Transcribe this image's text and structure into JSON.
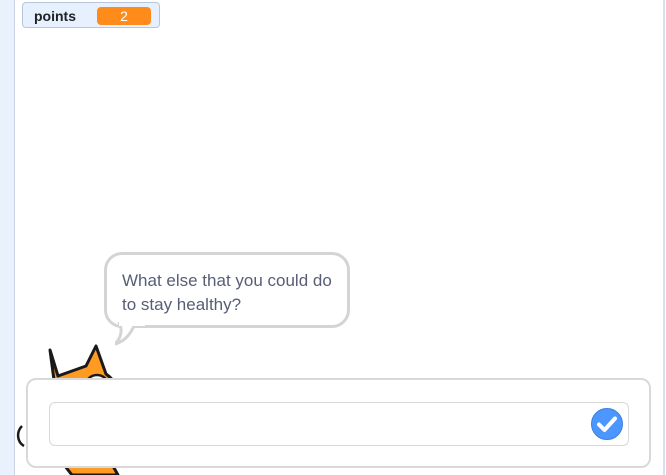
{
  "variable_monitor": {
    "label": "points",
    "value": "2"
  },
  "speech_bubble": {
    "text": "What else that you could do to stay healthy?"
  },
  "ask_prompt": {
    "answer_value": "",
    "submit_icon": "check-circle-icon"
  },
  "colors": {
    "monitor_value_bg": "#ff8c1a",
    "submit_blue": "#4c97ff",
    "bubble_text": "#575e75"
  }
}
